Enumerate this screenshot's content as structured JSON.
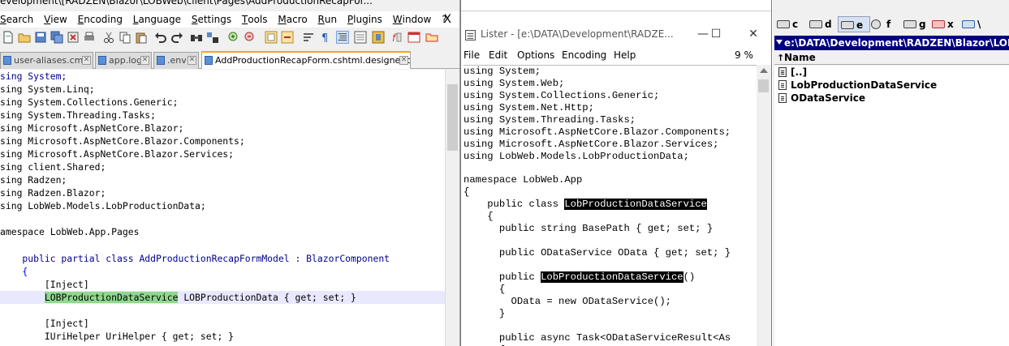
{
  "notepadpp": {
    "title": "evelopment\\[RADZEN\\Blazor\\LOBWeb\\client\\Pages\\AddProductionRecapFor...",
    "menu": [
      "Search",
      "View",
      "Encoding",
      "Language",
      "Settings",
      "Tools",
      "Macro",
      "Run",
      "Plugins",
      "Window",
      "?"
    ],
    "menu_close": "X",
    "tabs": [
      {
        "label": "user-aliases.cmd",
        "active": false
      },
      {
        "label": "app.log",
        "active": false
      },
      {
        "label": ".env",
        "active": false
      },
      {
        "label": "AddProductionRecapForm.cshtml.designer.cs",
        "active": true
      }
    ],
    "code_lines": [
      "sing System;",
      "sing System.Linq;",
      "sing System.Collections.Generic;",
      "sing System.Threading.Tasks;",
      "sing Microsoft.AspNetCore.Blazor;",
      "sing Microsoft.AspNetCore.Blazor.Components;",
      "sing Microsoft.AspNetCore.Blazor.Services;",
      "sing client.Shared;",
      "sing Radzen;",
      "sing Radzen.Blazor;",
      "sing LobWeb.Models.LobProductionData;",
      "",
      "amespace LobWeb.App.Pages",
      "",
      "    public partial class AddProductionRecapFormModel : BlazorComponent",
      "    {",
      "        [Inject]",
      "        LOBProductionDataService LOBProductionData { get; set; }",
      "",
      "        [Inject]",
      "        IUriHelper UriHelper { get; set; }"
    ],
    "highlight_word": "LOBProductionDataService"
  },
  "lister": {
    "title": "Lister - [e:\\DATA\\Development\\RADZE...",
    "window_buttons": [
      "—",
      "☐",
      "✕"
    ],
    "menu": [
      "File",
      "Edit",
      "Options",
      "Encoding",
      "Help"
    ],
    "percent": "9 %",
    "code_lines": [
      "using System;",
      "using System.Web;",
      "using System.Collections.Generic;",
      "using System.Net.Http;",
      "using System.Threading.Tasks;",
      "using Microsoft.AspNetCore.Blazor.Components;",
      "using Microsoft.AspNetCore.Blazor.Services;",
      "using LobWeb.Models.LobProductionData;",
      "",
      "namespace LobWeb.App",
      "{",
      "    public class LobProductionDataService",
      "    {",
      "      public string BasePath { get; set; }",
      "",
      "      public ODataService OData { get; set; }",
      "",
      "      public LobProductionDataService()",
      "      {",
      "        OData = new ODataService();",
      "      }",
      "",
      "      public async Task<ODataServiceResult<As",
      "      {"
    ],
    "selected_word": "LobProductionDataService"
  },
  "totalcmd": {
    "drives": [
      {
        "label": "c",
        "active": false
      },
      {
        "label": "d",
        "active": false
      },
      {
        "label": "e",
        "active": true
      },
      {
        "label": "f",
        "active": false
      },
      {
        "label": "g",
        "active": false
      },
      {
        "label": "x",
        "active": false
      },
      {
        "label": "\\",
        "active": false
      }
    ],
    "path": "e:\\DATA\\Development\\RADZEN\\Blazor\\LOBWeb",
    "column_header": "Name",
    "sort_indicator": "↑",
    "files": [
      "[..]",
      "LobProductionDataService",
      "ODataService"
    ]
  }
}
